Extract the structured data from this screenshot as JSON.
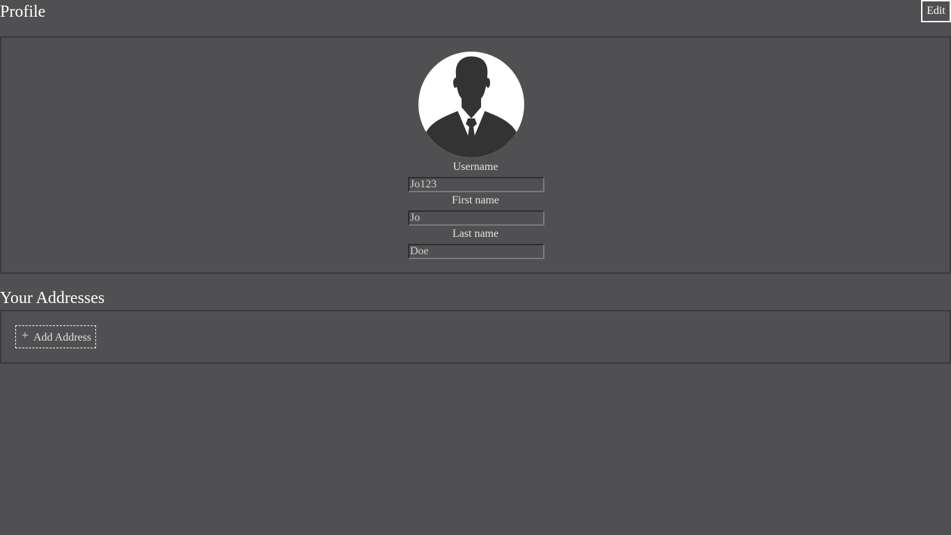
{
  "header": {
    "title": "Profile",
    "edit_label": "Edit"
  },
  "profile": {
    "avatar_icon": "user-silhouette-icon",
    "fields": [
      {
        "label": "Username",
        "value": "Jo123"
      },
      {
        "label": "First name",
        "value": "Jo"
      },
      {
        "label": "Last name",
        "value": "Doe"
      }
    ]
  },
  "addresses": {
    "title": "Your Addresses",
    "add_icon": "plus-icon",
    "add_label": "Add Address"
  },
  "colors": {
    "background": "#505052",
    "panel_border": "#3a3a3c",
    "text": "#ffffff",
    "avatar_silhouette": "#333333"
  }
}
